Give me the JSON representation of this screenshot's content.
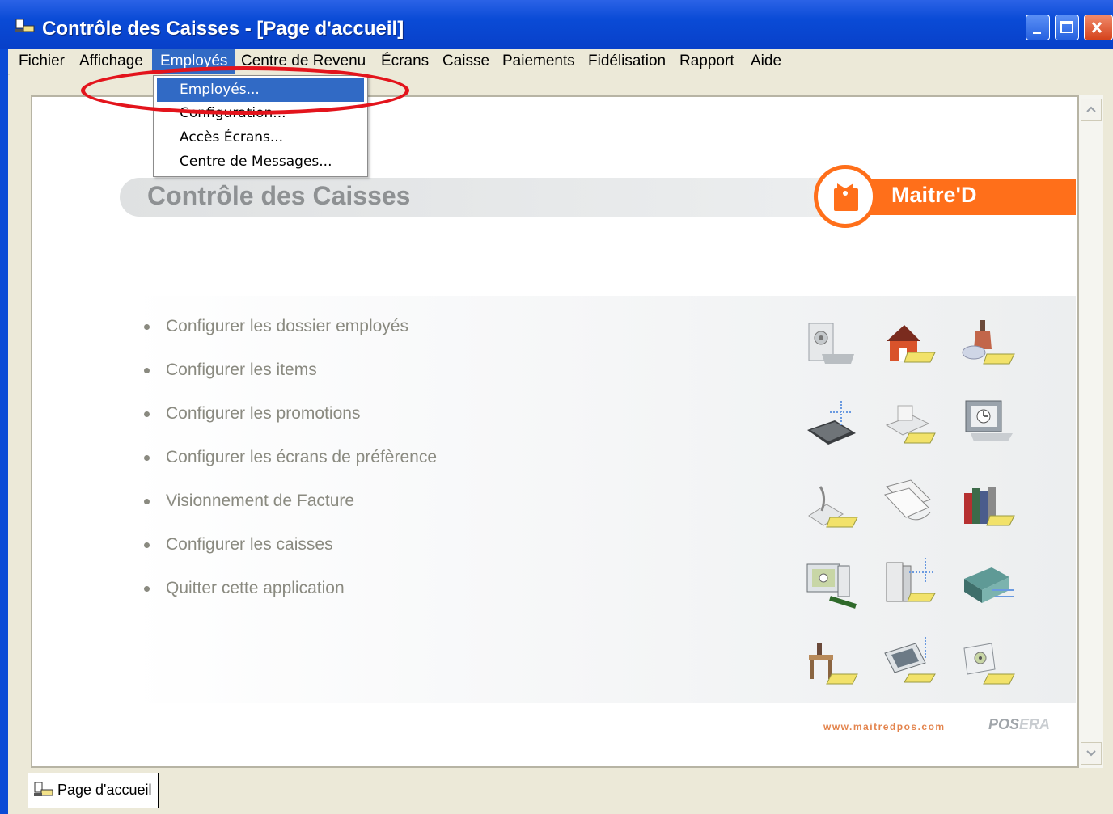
{
  "window": {
    "title": "Contrôle des Caisses - [Page d'accueil]",
    "controls": [
      "minimize-icon",
      "maximize-icon",
      "close-icon"
    ]
  },
  "menubar": {
    "items": [
      "Fichier",
      "Affichage",
      "Employés",
      "Centre de Revenu",
      "Écrans",
      "Caisse",
      "Paiements",
      "Fidélisation",
      "Rapport",
      "Aide"
    ],
    "active": "Employés"
  },
  "dropdown": {
    "items": [
      "Employés...",
      "Configuration...",
      "Accès Écrans...",
      "Centre de Messages..."
    ],
    "selected": "Employés..."
  },
  "banner": {
    "title": "Contrôle des Caisses",
    "brand": "Maitre'D"
  },
  "links": [
    "Configurer les dossier employés",
    "Configurer les items",
    "Configurer les promotions",
    "Configurer les écrans de préfèrence",
    "Visionnement de Facture",
    "Configurer les caisses",
    "Quitter cette application"
  ],
  "icon_grid": [
    [
      "scanner-icon",
      "house-icon",
      "wine-bottle-icon"
    ],
    [
      "laptop-icon",
      "printer-icon",
      "clock-monitor-icon"
    ],
    [
      "quill-icon",
      "papers-icon",
      "books-icon"
    ],
    [
      "computer-icon",
      "server-icon",
      "network-box-icon"
    ],
    [
      "table-icon",
      "screen-icon",
      "monitor-disc-icon"
    ]
  ],
  "footer": {
    "url": "www.maitredpos.com",
    "logo_a": "POS",
    "logo_b": "ERA"
  },
  "statusbar": {
    "tab_label": "Page d'accueil"
  },
  "colors": {
    "brand_orange": "#ff6f1a",
    "selection_blue": "#316ac5",
    "annotation_red": "#e3141c"
  }
}
